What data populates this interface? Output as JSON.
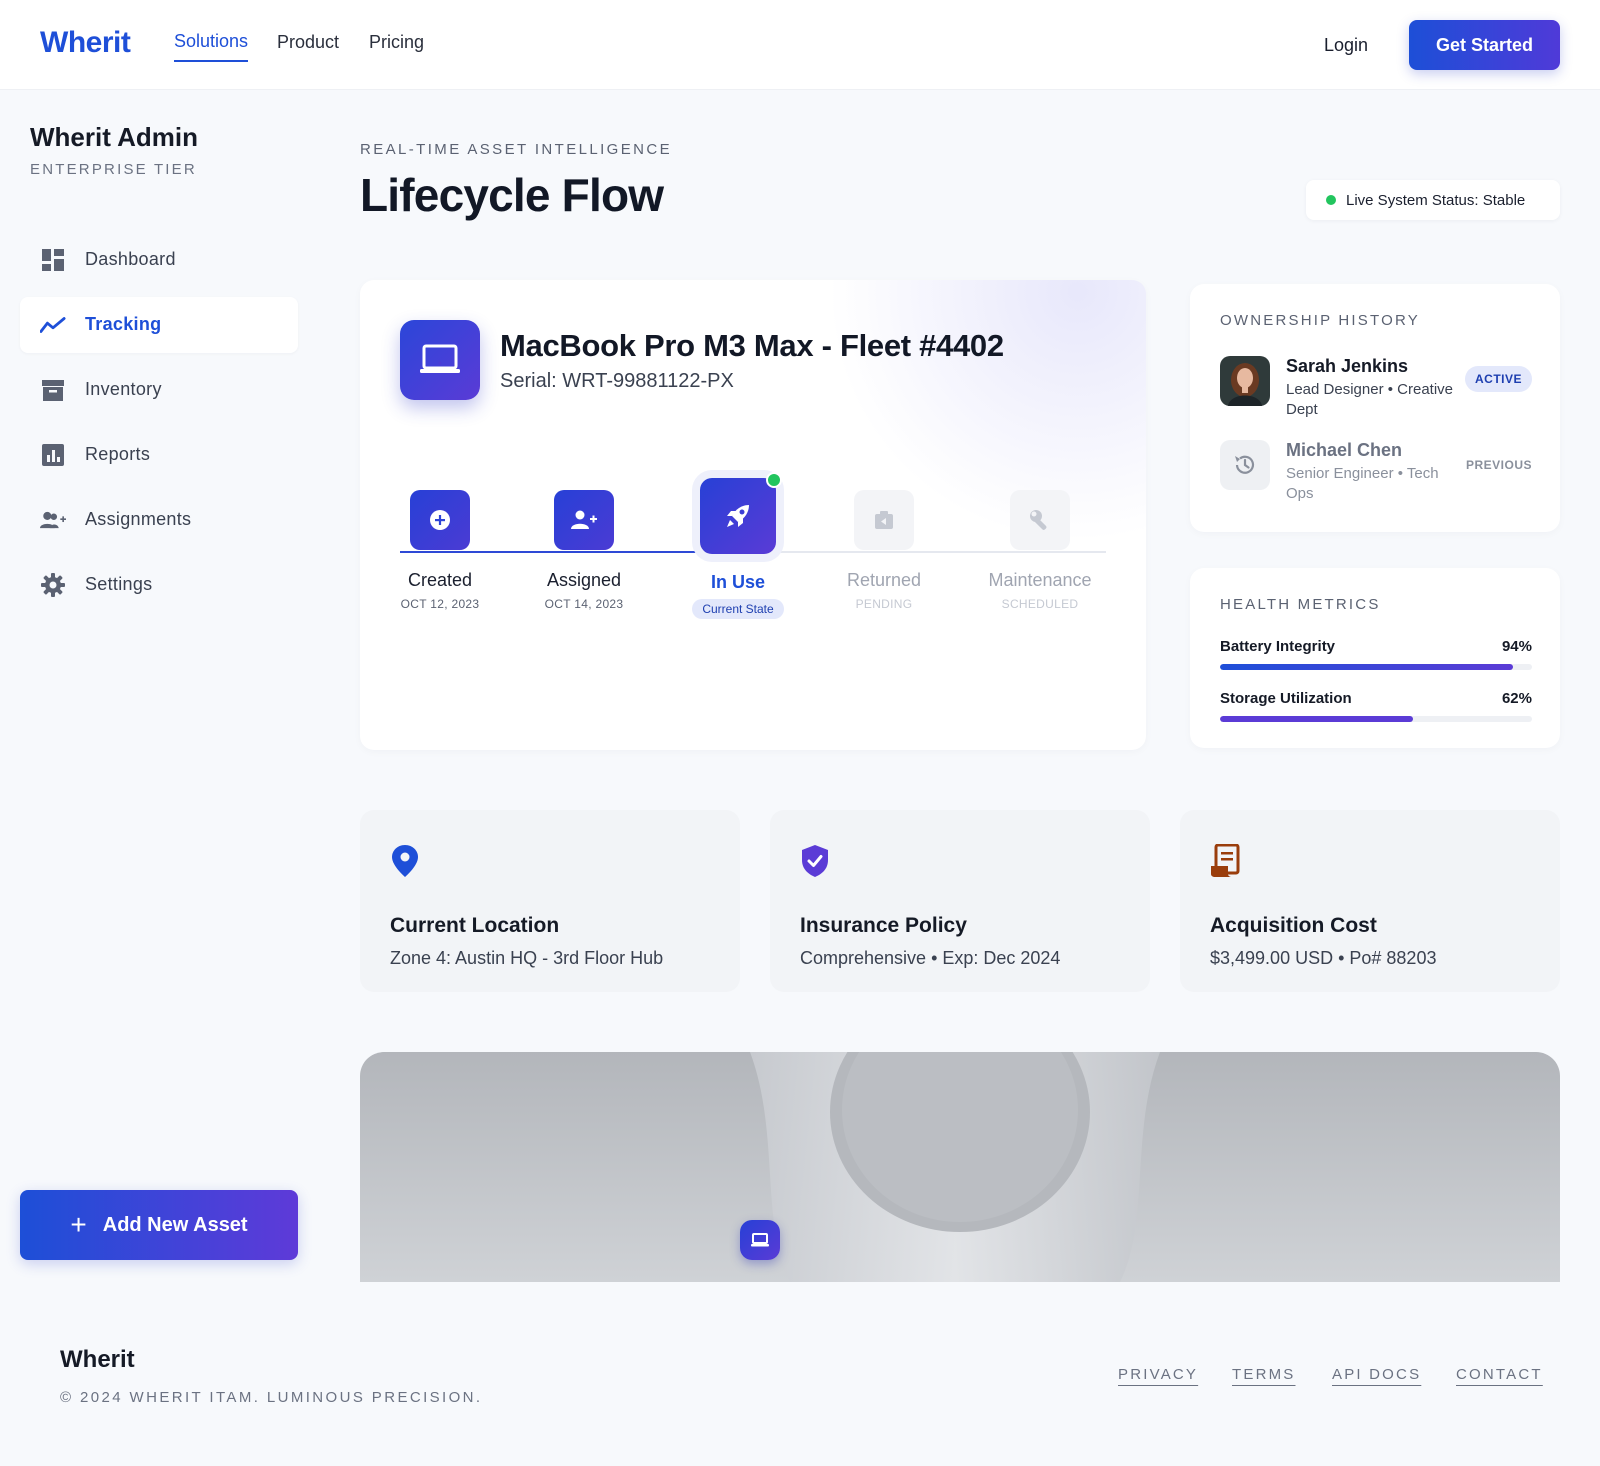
{
  "nav": {
    "brand": "Wherit",
    "links": [
      "Solutions",
      "Product",
      "Pricing"
    ],
    "login": "Login",
    "cta": "Get Started"
  },
  "sidebar": {
    "title": "Wherit Admin",
    "tier": "ENTERPRISE TIER",
    "items": [
      {
        "label": "Dashboard",
        "icon": "dashboard-icon"
      },
      {
        "label": "Tracking",
        "icon": "trending-up-icon"
      },
      {
        "label": "Inventory",
        "icon": "archive-box-icon"
      },
      {
        "label": "Reports",
        "icon": "bar-chart-icon"
      },
      {
        "label": "Assignments",
        "icon": "user-plus-icon"
      },
      {
        "label": "Settings",
        "icon": "gear-icon"
      }
    ],
    "active": "Tracking",
    "add_asset": "Add New Asset"
  },
  "header": {
    "eyebrow": "REAL-TIME ASSET INTELLIGENCE",
    "title": "Lifecycle Flow",
    "status": "Live System Status: Stable"
  },
  "asset": {
    "name": "MacBook Pro M3 Max - Fleet #4402",
    "serial": "Serial: WRT-99881122-PX",
    "steps": [
      {
        "title": "Created",
        "sub": "OCT 12, 2023",
        "state": "done"
      },
      {
        "title": "Assigned",
        "sub": "OCT 14, 2023",
        "state": "done"
      },
      {
        "title": "In Use",
        "sub": "Current State",
        "state": "current"
      },
      {
        "title": "Returned",
        "sub": "PENDING",
        "state": "pending"
      },
      {
        "title": "Maintenance",
        "sub": "SCHEDULED",
        "state": "pending"
      }
    ]
  },
  "ownership": {
    "heading": "OWNERSHIP HISTORY",
    "owners": [
      {
        "name": "Sarah Jenkins",
        "role": "Lead Designer • Creative Dept",
        "badge": "ACTIVE"
      },
      {
        "name": "Michael Chen",
        "role": "Senior Engineer • Tech Ops",
        "badge": "PREVIOUS"
      }
    ]
  },
  "health": {
    "heading": "HEALTH METRICS",
    "metrics": [
      {
        "label": "Battery Integrity",
        "value": "94%",
        "fraction": 0.94
      },
      {
        "label": "Storage Utilization",
        "value": "62%",
        "fraction": 0.62
      }
    ]
  },
  "info": [
    {
      "title": "Current Location",
      "value": "Zone 4: Austin HQ - 3rd Floor Hub",
      "icon": "map-pin-icon",
      "color": "#1e4fd8"
    },
    {
      "title": "Insurance Policy",
      "value": "Comprehensive • Exp: Dec 2024",
      "icon": "shield-check-icon",
      "color": "#5b3bd6"
    },
    {
      "title": "Acquisition Cost",
      "value": "$3,499.00 USD • Po# 88203",
      "icon": "receipt-icon",
      "color": "#9a3d0c"
    }
  ],
  "footer": {
    "brand": "Wherit",
    "copyright": "© 2024 WHERIT ITAM. LUMINOUS PRECISION.",
    "links": [
      "PRIVACY",
      "TERMS",
      "API DOCS",
      "CONTACT"
    ]
  },
  "colors": {
    "primary": "#1e4fd8",
    "accent": "#5b3bd6",
    "success": "#22c55e"
  }
}
